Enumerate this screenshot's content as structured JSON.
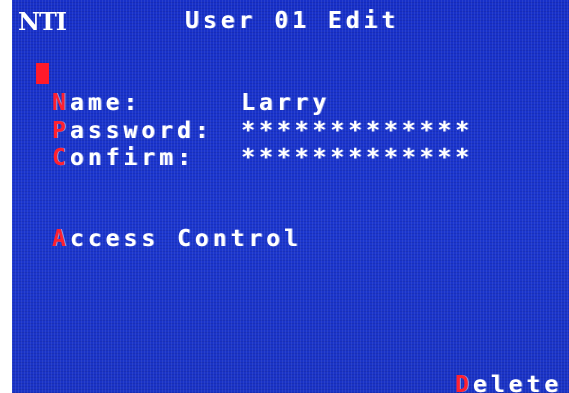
{
  "osd": {
    "logo": "NTI",
    "title": "User 01 Edit",
    "fields": {
      "name": {
        "hotkey": "N",
        "label": "ame:",
        "value": "Larry"
      },
      "password": {
        "hotkey": "P",
        "label": "assword:",
        "value": "*************"
      },
      "confirm": {
        "hotkey": "C",
        "label": "onfirm:",
        "value": "*************"
      }
    },
    "access": {
      "hotkey": "A",
      "label": "ccess Control"
    },
    "delete": {
      "hotkey": "D",
      "label": "elete"
    },
    "colors": {
      "background": "#1a33c8",
      "text": "#ffffff",
      "hotkey": "#ff2030",
      "cursor": "#ff1a2a"
    }
  }
}
